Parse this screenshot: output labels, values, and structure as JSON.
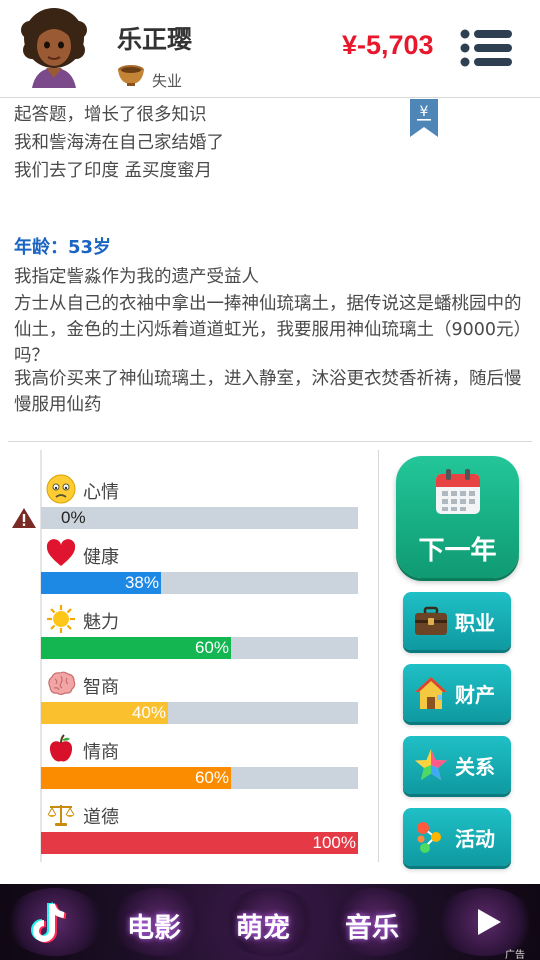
{
  "header": {
    "name": "乐正璎",
    "job": "失业",
    "money": "¥-5,703"
  },
  "log": {
    "bookmark_symbol": "¥",
    "lines": [
      "起答题，增长了很多知识",
      "我和訾海涛在自己家结婚了",
      "我们去了印度 孟买度蜜月",
      "年龄：53岁",
      "我指定訾淼作为我的遗产受益人",
      "方士从自己的衣袖中拿出一捧神仙琉璃土，据传说这是蟠桃园中的仙土，金色的土闪烁着道道虹光，我要服用神仙琉璃土（9000元）吗？",
      "我高价买来了神仙琉璃土，进入静室，沐浴更衣焚香祈祷，随后慢慢服用仙药"
    ]
  },
  "stats": [
    {
      "label": "心情",
      "value": 0,
      "text": "0%",
      "color": "#cbd4dc",
      "icon": "sad-face-icon"
    },
    {
      "label": "健康",
      "value": 38,
      "text": "38%",
      "color": "#1e88e5",
      "icon": "heart-icon"
    },
    {
      "label": "魅力",
      "value": 60,
      "text": "60%",
      "color": "#13b650",
      "icon": "sun-icon"
    },
    {
      "label": "智商",
      "value": 40,
      "text": "40%",
      "color": "#fbc02d",
      "icon": "brain-icon"
    },
    {
      "label": "情商",
      "value": 60,
      "text": "60%",
      "color": "#fb8c00",
      "icon": "apple-icon"
    },
    {
      "label": "道德",
      "value": 100,
      "text": "100%",
      "color": "#e53946",
      "icon": "scales-icon"
    }
  ],
  "buttons": {
    "next_year": "下一年",
    "career": "职业",
    "property": "财产",
    "relations": "关系",
    "activity": "活动"
  },
  "banner": {
    "items": [
      "电影",
      "萌宠",
      "音乐"
    ],
    "ad_label": "广告"
  },
  "colors": {
    "money": "#e8172b",
    "age": "#1a64c2",
    "button_teal": "#14a9b0",
    "next_green": "#19b386"
  }
}
